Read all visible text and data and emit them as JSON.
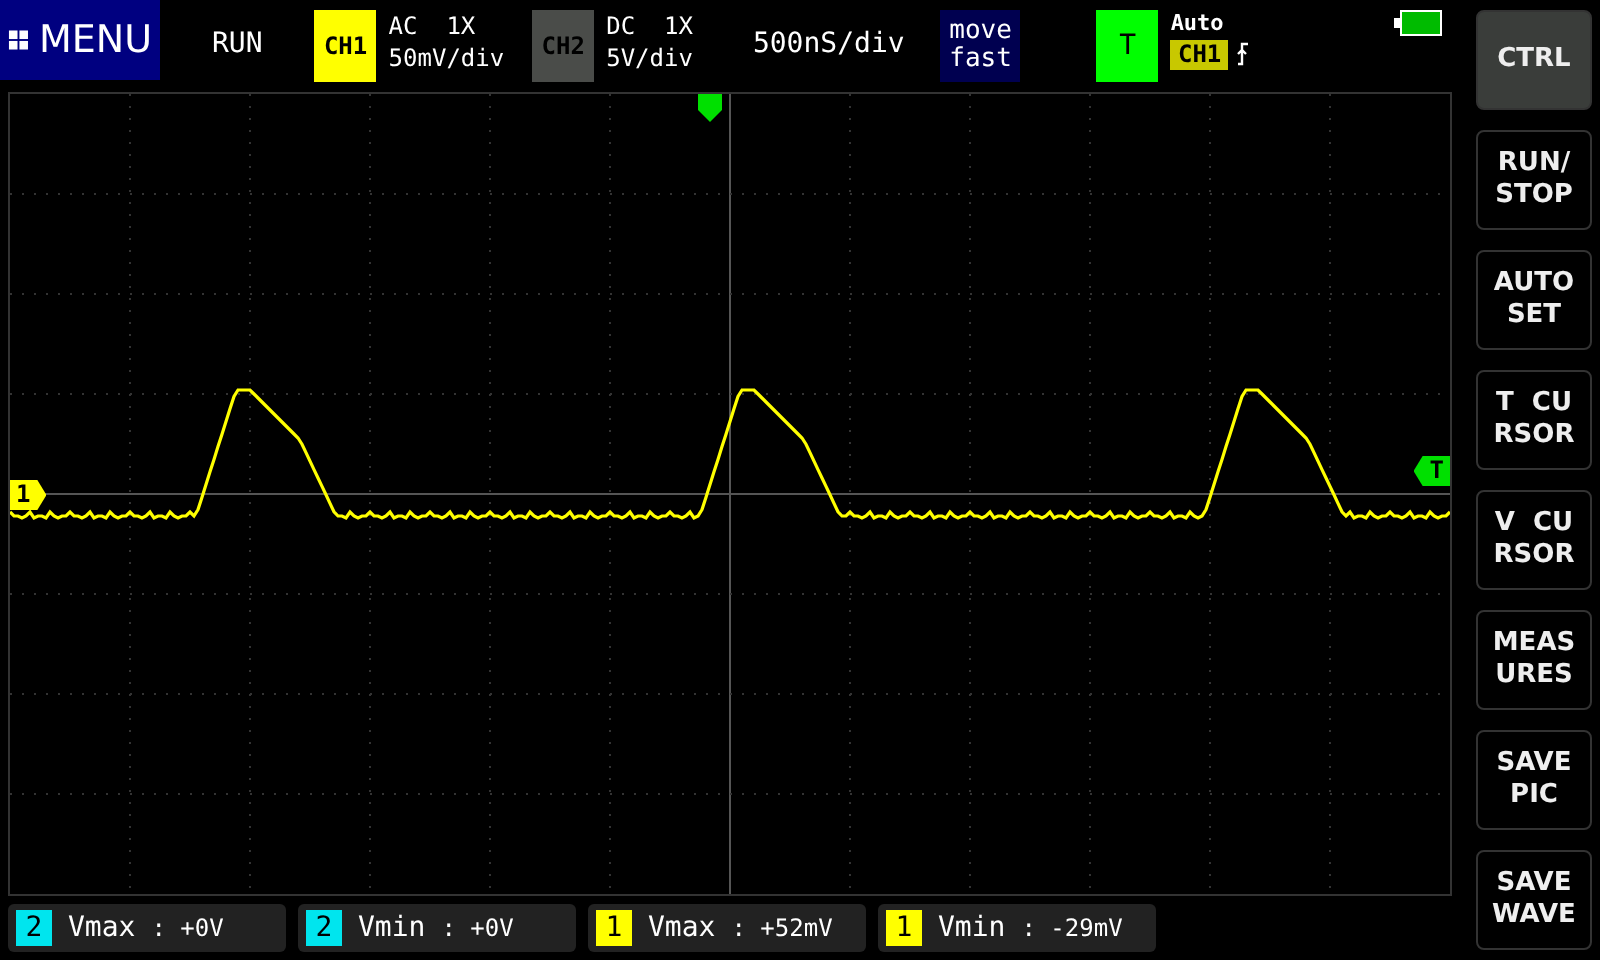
{
  "menu": {
    "label": "MENU"
  },
  "run_state": "RUN",
  "channels": [
    {
      "badge": "CH1",
      "coupling": "AC  1X",
      "scale": "50mV/div",
      "color": "#ffff00"
    },
    {
      "badge": "CH2",
      "coupling": "DC  1X",
      "scale": "5V/div",
      "color": "#4a4c49"
    }
  ],
  "timebase": "500nS/div",
  "move_mode": {
    "line1": "move",
    "line2": "fast"
  },
  "trigger": {
    "badge": "T",
    "mode": "Auto",
    "source": "CH1",
    "level_marker": "T",
    "channel_marker": "1"
  },
  "side_buttons": [
    {
      "label": "CTRL",
      "selected": true
    },
    {
      "label": "RUN/\nSTOP",
      "selected": false
    },
    {
      "label": "AUTO\nSET",
      "selected": false
    },
    {
      "label": "T  CU\nRSOR",
      "selected": false
    },
    {
      "label": "V  CU\nRSOR",
      "selected": false
    },
    {
      "label": "MEAS\nURES",
      "selected": false
    },
    {
      "label": "SAVE\nPIC",
      "selected": false
    },
    {
      "label": "SAVE\nWAVE",
      "selected": false
    }
  ],
  "measurements": [
    {
      "channel": "2",
      "label": "Vmax",
      "value": ": +0V",
      "color": "#00e5ee"
    },
    {
      "channel": "2",
      "label": "Vmin",
      "value": ": +0V",
      "color": "#00e5ee"
    },
    {
      "channel": "1",
      "label": "Vmax",
      "value": ": +52mV",
      "color": "#ffff00"
    },
    {
      "channel": "1",
      "label": "Vmin",
      "value": ": -29mV",
      "color": "#ffff00"
    }
  ]
}
